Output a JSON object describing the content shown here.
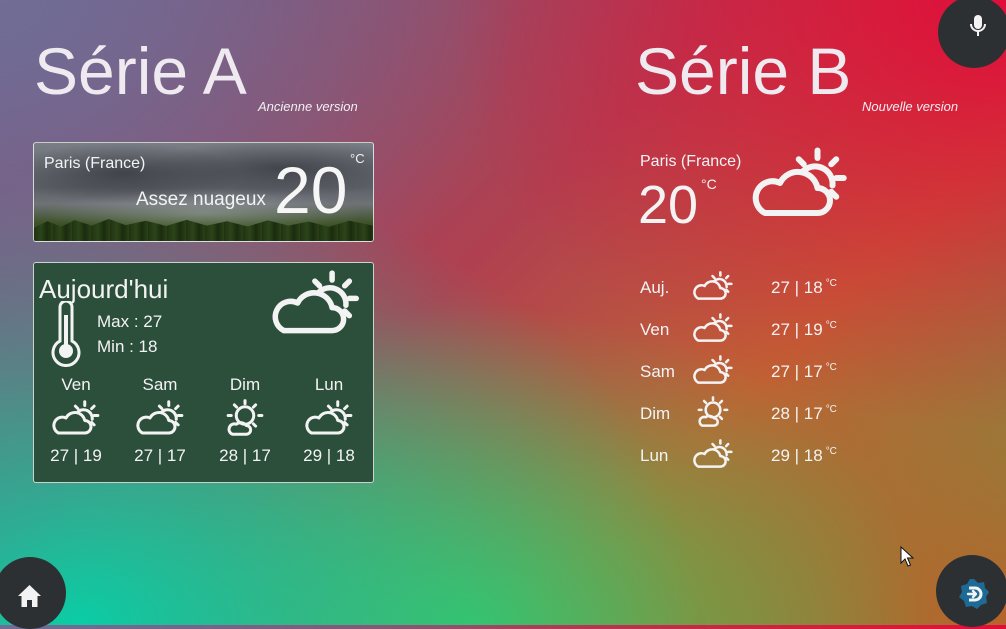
{
  "serie_a": {
    "title": "Série A",
    "version": "Ancienne version",
    "now": {
      "city": "Paris (France)",
      "condition": "Assez nuageux",
      "temp": "20",
      "unit": "°C",
      "icon": "cloud-sun-icon"
    },
    "today": {
      "label": "Aujourd'hui",
      "max": "Max : 27",
      "min": "Min : 18",
      "icon": "cloud-sun-icon"
    },
    "days": [
      {
        "name": "Ven",
        "temps": "27 | 19",
        "icon": "cloud-sun-icon"
      },
      {
        "name": "Sam",
        "temps": "27 | 17",
        "icon": "cloud-sun-icon"
      },
      {
        "name": "Dim",
        "temps": "28 | 17",
        "icon": "sun-cloud-icon"
      },
      {
        "name": "Lun",
        "temps": "29 | 18",
        "icon": "cloud-sun-icon"
      }
    ]
  },
  "serie_b": {
    "title": "Série B",
    "version": "Nouvelle version",
    "now": {
      "city": "Paris (France)",
      "temp": "20",
      "unit": "°C",
      "icon": "cloud-sun-icon"
    },
    "rows": [
      {
        "name": "Auj.",
        "temps": "27 | 18",
        "unit": "°C",
        "icon": "cloud-sun-icon"
      },
      {
        "name": "Ven",
        "temps": "27 | 19",
        "unit": "°C",
        "icon": "cloud-sun-icon"
      },
      {
        "name": "Sam",
        "temps": "27 | 17",
        "unit": "°C",
        "icon": "cloud-sun-icon"
      },
      {
        "name": "Dim",
        "temps": "28 | 17",
        "unit": "°C",
        "icon": "sun-cloud-icon"
      },
      {
        "name": "Lun",
        "temps": "29 | 18",
        "unit": "°C",
        "icon": "cloud-sun-icon"
      }
    ]
  },
  "buttons": {
    "mic": "microphone-icon",
    "home": "home-icon",
    "app": "app-logo-icon"
  },
  "colors": {
    "forecast_card": "#2c4f3c",
    "corner": "#2d3033",
    "text": "#f3f3f3",
    "app_logo": "#1d6a96"
  }
}
